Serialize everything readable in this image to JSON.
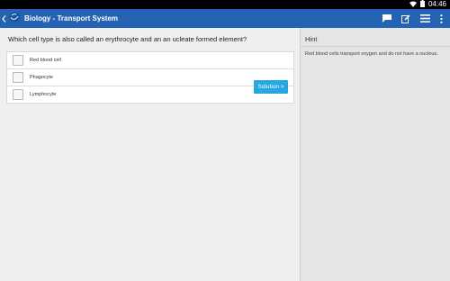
{
  "status_bar": {
    "time": "04:46",
    "icons": [
      "wifi-icon",
      "battery-icon"
    ]
  },
  "app_bar": {
    "title": "Biology - Transport System",
    "icons": [
      "back-chevron-icon",
      "app-logo-icon",
      "chat-icon",
      "note-edit-icon",
      "list-menu-icon",
      "overflow-menu-icon"
    ],
    "color": "#2463b3"
  },
  "question": {
    "text": "Which cell type is also called an erythrocyte and an an ucleate formed element?",
    "options": [
      {
        "label": "Red blood cell"
      },
      {
        "label": "Phagocyte"
      },
      {
        "label": "Lymphocyte"
      }
    ],
    "solution_button": "Solution >",
    "button_color": "#27a6df"
  },
  "hint": {
    "title": "Hint",
    "text": "Red blood cells transport oxygen and do not have a nucleus."
  }
}
